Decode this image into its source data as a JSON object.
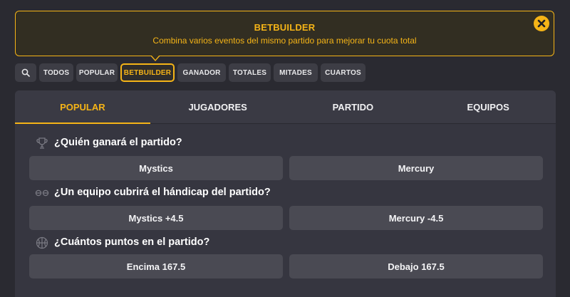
{
  "banner": {
    "title": "BETBUILDER",
    "subtitle": "Combina varios eventos del mismo partido para mejorar tu cuota total"
  },
  "filters": {
    "items": [
      "TODOS",
      "POPULAR",
      "BETBUILDER",
      "GANADOR",
      "TOTALES",
      "MITADES",
      "CUARTOS"
    ],
    "active": "BETBUILDER"
  },
  "tabs": {
    "items": [
      "POPULAR",
      "JUGADORES",
      "PARTIDO",
      "EQUIPOS"
    ],
    "active": "POPULAR"
  },
  "markets": [
    {
      "title": "¿Quién ganará el partido?",
      "icon": "trophy-icon",
      "options": [
        "Mystics",
        "Mercury"
      ]
    },
    {
      "title": "¿Un equipo cubrirá el hándicap del partido?",
      "icon": "handicap-icon",
      "options": [
        "Mystics +4.5",
        "Mercury -4.5"
      ]
    },
    {
      "title": "¿Cuántos puntos en el partido?",
      "icon": "basketball-icon",
      "options": [
        "Encima 167.5",
        "Debajo 167.5"
      ]
    }
  ],
  "colors": {
    "accent": "#f5b417",
    "background": "#2a2a31",
    "panel": "#363640",
    "button": "#4a4a53"
  }
}
